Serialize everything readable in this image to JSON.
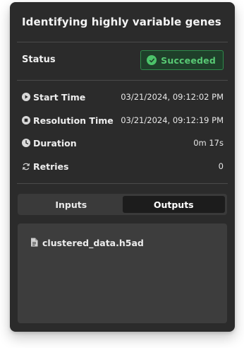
{
  "panel": {
    "title": "Identifying highly variable genes"
  },
  "status": {
    "label": "Status",
    "badge_text": "Succeeded",
    "badge_icon": "check-circle-icon"
  },
  "details": [
    {
      "label": "Start Time",
      "value": "03/21/2024, 09:12:02 PM",
      "icon": "play-circle-icon"
    },
    {
      "label": "Resolution Time",
      "value": "03/21/2024, 09:12:19 PM",
      "icon": "stop-circle-icon"
    },
    {
      "label": "Duration",
      "value": "0m 17s",
      "icon": "clock-icon"
    },
    {
      "label": "Retries",
      "value": "0",
      "icon": "refresh-icon"
    }
  ],
  "tabs": [
    {
      "label": "Inputs",
      "active": false
    },
    {
      "label": "Outputs",
      "active": true
    }
  ],
  "outputs": {
    "files": [
      {
        "name": "clustered_data.h5ad",
        "icon": "file-icon"
      }
    ]
  },
  "colors": {
    "card_bg": "#2b2b2b",
    "success_green": "#58c974",
    "success_bg": "#1f3f2a"
  }
}
